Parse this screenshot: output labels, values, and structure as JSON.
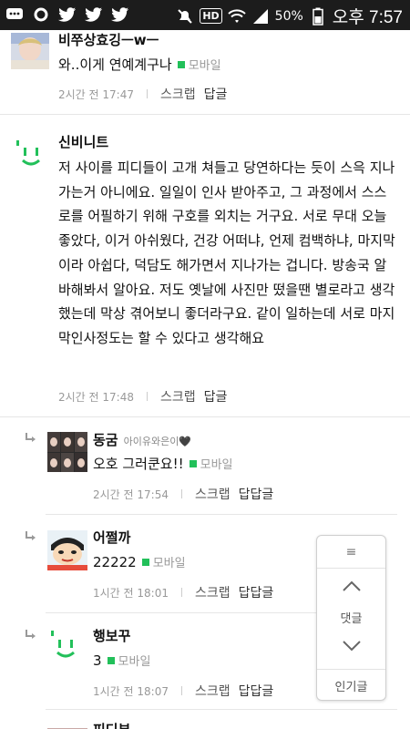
{
  "status_bar": {
    "battery_percent": "50%",
    "time": "오후 7:57",
    "hd_label": "HD"
  },
  "comments": [
    {
      "nick": "비쭈상효깅ㅡwㅡ",
      "body": "와..이게 연예계구나",
      "mobile": "모바일",
      "time": "2시간 전 17:47",
      "scrap": "스크랩",
      "reply": "답글"
    },
    {
      "nick": "신비니트",
      "body": "저 사이를 피디들이 고개 쳐들고 당연하다는 듯이 스윽 지나가는거 아니에요. 일일이 인사 받아주고, 그 과정에서 스스로를 어필하기 위해 구호를 외치는 거구요. 서로 무대 오늘 좋았다, 이거 아쉬웠다, 건강 어떠냐, 언제 컴백하냐, 마지막이라 아쉽다, 덕담도 해가면서 지나가는 겁니다. 방송국 알바해봐서 알아요. 저도 옛날에 사진만 떴을땐 별로라고 생각했는데 막상 겪어보니 좋더라구요. 같이 일하는데 서로 마지막인사정도는 할 수 있다고 생각해요",
      "time": "2시간 전 17:48",
      "scrap": "스크랩",
      "reply": "답글"
    }
  ],
  "replies": [
    {
      "nick": "동굼",
      "sub": "아이유와은이🖤",
      "body": "오호 그러쿤요!!",
      "mobile": "모바일",
      "time": "2시간 전 17:54",
      "scrap": "스크랩",
      "reply": "답답글"
    },
    {
      "nick": "어쩔까",
      "body": "22222",
      "mobile": "모바일",
      "time": "1시간 전 18:01",
      "scrap": "스크랩",
      "reply": "답답글"
    },
    {
      "nick": "행보꾸",
      "body": "3",
      "mobile": "모바일",
      "time": "1시간 전 18:07",
      "scrap": "스크랩",
      "reply": "답답글"
    }
  ],
  "float_panel": {
    "menu_icon": "≡",
    "comments_label": "댓글",
    "popular_label": "인기글"
  },
  "partial_next": {
    "nick": "피디부"
  },
  "colors": {
    "mobile_green": "#22c05a",
    "status_bar": "#1c1c1c"
  }
}
